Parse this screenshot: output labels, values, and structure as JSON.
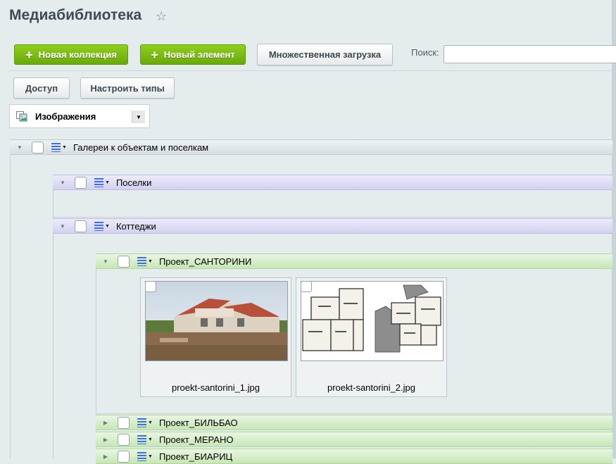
{
  "page": {
    "title": "Медиабиблиотека",
    "favorite_icon": "star-outline-icon"
  },
  "toolbar": {
    "new_collection": "Новая коллекция",
    "new_element": "Новый элемент",
    "bulk_upload": "Множественная загрузка",
    "search_label": "Поиск:",
    "search_value": "",
    "access": "Доступ",
    "configure_types": "Настроить типы"
  },
  "type_select": {
    "selected": "Изображения",
    "icon": "images-icon"
  },
  "tree": {
    "root": {
      "label": "Галереи к объектам и поселкам"
    },
    "posyolki": {
      "label": "Поселки"
    },
    "cottages": {
      "label": "Коттеджи"
    },
    "santorini": {
      "label": "Проект_САНТОРИНИ"
    },
    "bilbao": {
      "label": "Проект_БИЛЬБАО"
    },
    "merano": {
      "label": "Проект_МЕРАНО"
    },
    "biarritz": {
      "label": "Проект_БИАРИЦ"
    }
  },
  "items": [
    {
      "filename": "proekt-santorini_1.jpg",
      "kind": "house-photo"
    },
    {
      "filename": "proekt-santorini_2.jpg",
      "kind": "floor-plan"
    }
  ],
  "colors": {
    "green_button": "#7fbf14",
    "lavender_bar": "#d3d1ef",
    "green_bar": "#c7e6b6",
    "background": "#e4ecee"
  }
}
